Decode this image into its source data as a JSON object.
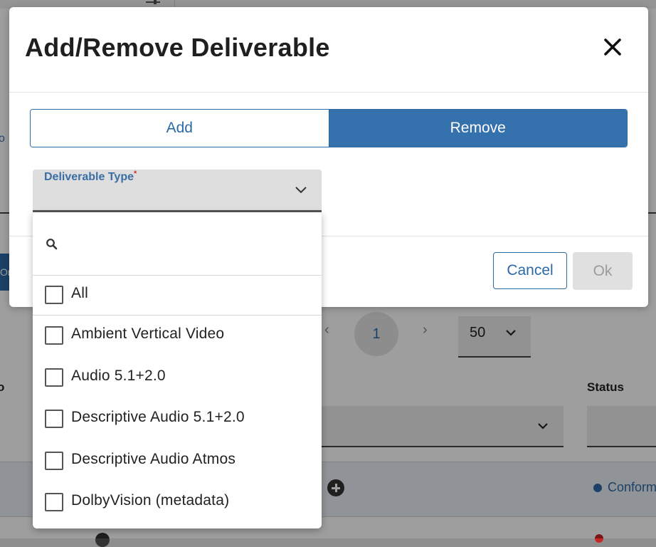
{
  "background": {
    "side_link": "o",
    "side_button": "Or",
    "pager": {
      "prev": "‹",
      "current": "1",
      "next": "›"
    },
    "per_page": "50",
    "col_left_header": "o",
    "col_status_header": "Status",
    "row_status": "Conform",
    "colors": {
      "status_blue": "#2c6aa6",
      "status_red": "#c62828"
    }
  },
  "modal": {
    "title": "Add/Remove Deliverable",
    "close_icon": "close-icon",
    "segments": {
      "add": "Add",
      "remove": "Remove",
      "selected": "Remove"
    },
    "deliverable_type": {
      "label": "Deliverable Type",
      "required_mark": "*",
      "value": ""
    },
    "footer": {
      "cancel": "Cancel",
      "ok": "Ok"
    },
    "colors": {
      "primary": "#2c6aa6",
      "selected_segment": "#3471ad",
      "disabled": "#e0e0e0"
    }
  },
  "dropdown": {
    "search": {
      "placeholder": "",
      "value": ""
    },
    "all_label": "All",
    "options": [
      "Ambient Vertical Video",
      "Audio 5.1+2.0",
      "Descriptive Audio 5.1+2.0",
      "Descriptive Audio Atmos",
      "DolbyVision (metadata)"
    ]
  }
}
